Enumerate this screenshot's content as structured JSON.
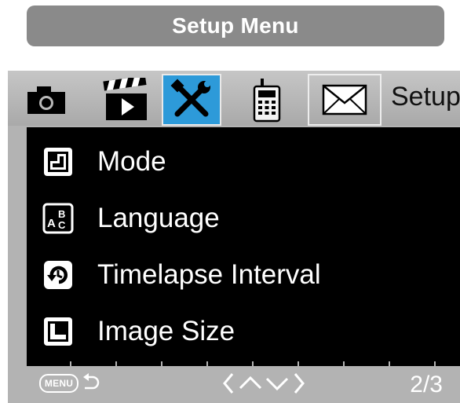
{
  "header": {
    "title": "Setup Menu"
  },
  "tabs": [
    {
      "icon": "camera-icon",
      "label": ""
    },
    {
      "icon": "video-clapper-icon",
      "label": ""
    },
    {
      "icon": "tools-icon",
      "label": "",
      "active": true
    },
    {
      "icon": "cellular-device-icon",
      "label": ""
    },
    {
      "icon": "envelope-icon",
      "label": ""
    }
  ],
  "active_tab_label": "Setup",
  "menu_items": [
    {
      "icon": "mode-icon",
      "label": "Mode"
    },
    {
      "icon": "language-icon",
      "label": "Language"
    },
    {
      "icon": "timelapse-icon",
      "label": "Timelapse Interval"
    },
    {
      "icon": "image-size-icon",
      "label": "Image Size"
    }
  ],
  "footer": {
    "menu_key": "MENU",
    "back_icon": "back-arrow-icon",
    "nav_icons": [
      "chevron-left-icon",
      "chevron-up-icon",
      "chevron-down-icon",
      "chevron-right-icon"
    ],
    "page_indicator": "2/3"
  },
  "colors": {
    "active_tab": "#2d9ad9",
    "list_background": "#000000",
    "frame": "#b3b3b3",
    "title_pill": "#8a8a8a"
  }
}
